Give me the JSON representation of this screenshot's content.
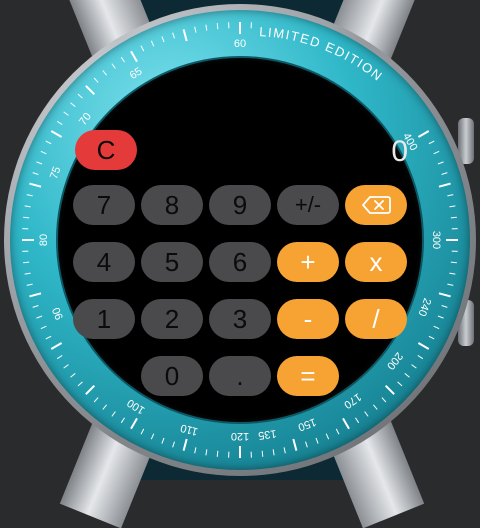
{
  "bezel": {
    "brand_text": "LIMITED EDITION",
    "tachymeter": [
      "60",
      "400",
      "300",
      "240",
      "200",
      "170",
      "150",
      "135",
      "120",
      "110",
      "100",
      "90",
      "80",
      "75",
      "70",
      "65"
    ]
  },
  "calculator": {
    "display_value": "0",
    "clear_label": "C",
    "backspace_icon": "backspace-icon",
    "rows": [
      [
        "7",
        "8",
        "9",
        "+/-"
      ],
      [
        "4",
        "5",
        "6",
        "+",
        "x"
      ],
      [
        "1",
        "2",
        "3",
        "-",
        "/"
      ],
      [
        "0",
        ".",
        "="
      ]
    ]
  },
  "colors": {
    "number_key": "#4a4a4d",
    "operator_key": "#f6a334",
    "clear_key": "#e53a3a",
    "bezel": "#2fb7c8",
    "screen": "#000000"
  }
}
